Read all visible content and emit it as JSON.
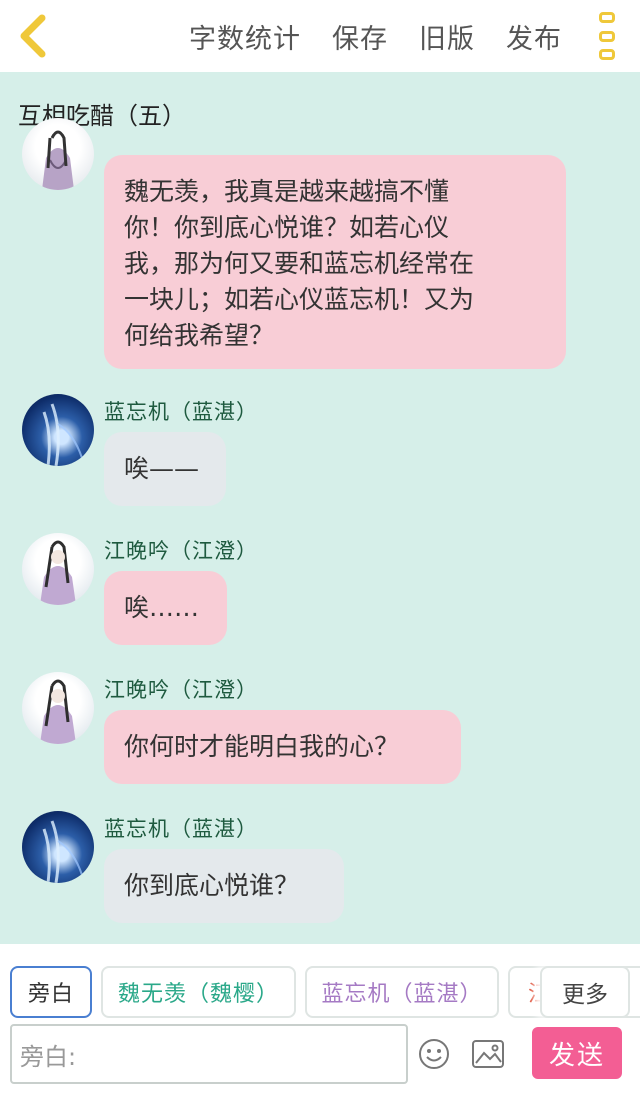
{
  "toolbar": {
    "back_icon": "chevron-left-icon",
    "actions": [
      "字数统计",
      "保存",
      "旧版",
      "发布"
    ],
    "more_icon": "vertical-dots-icon",
    "accent": "#efc83a"
  },
  "chapter_title": "互相吃醋（五）",
  "messages": [
    {
      "speaker": "",
      "avatar": "wei-wuxian-avatar",
      "style": "pink",
      "lines": [
        "魏无羡，我真是越来越搞不懂",
        "你！你到底心悦谁？如若心仪",
        "我，那为何又要和蓝忘机经常在",
        "一块儿；如若心仪蓝忘机！又为",
        "何给我希望？"
      ]
    },
    {
      "speaker": "蓝忘机（蓝湛）",
      "avatar": "lan-wangji-avatar",
      "style": "grey",
      "text": "唉——"
    },
    {
      "speaker": "江晚吟（江澄）",
      "avatar": "jiang-wanyin-avatar",
      "style": "pink",
      "text": "唉……"
    },
    {
      "speaker": "江晚吟（江澄）",
      "avatar": "jiang-wanyin-avatar",
      "style": "pink",
      "text": "你何时才能明白我的心？"
    },
    {
      "speaker": "蓝忘机（蓝湛）",
      "avatar": "lan-wangji-avatar",
      "style": "grey",
      "text": "你到底心悦谁？"
    }
  ],
  "role_chips": [
    {
      "label": "旁白",
      "color": "#333333",
      "border": "#4a7fd1",
      "selected": true
    },
    {
      "label": "魏无羡（魏樱）",
      "color": "#2aa889",
      "border": "#dfe5e3",
      "selected": false
    },
    {
      "label": "蓝忘机（蓝湛）",
      "color": "#a57ac4",
      "border": "#dfe5e3",
      "selected": false
    },
    {
      "label": "江",
      "color": "#e0533c",
      "border": "#dfe5e3",
      "selected": false
    }
  ],
  "more_label": "更多",
  "input": {
    "placeholder": "旁白:"
  },
  "send_label": "发送",
  "colors": {
    "background": "#d6efe9",
    "pink_bubble": "#f8cdd6",
    "grey_bubble": "#e4e9ec",
    "send_button": "#f35e94",
    "name_text": "#1e5a3f"
  }
}
